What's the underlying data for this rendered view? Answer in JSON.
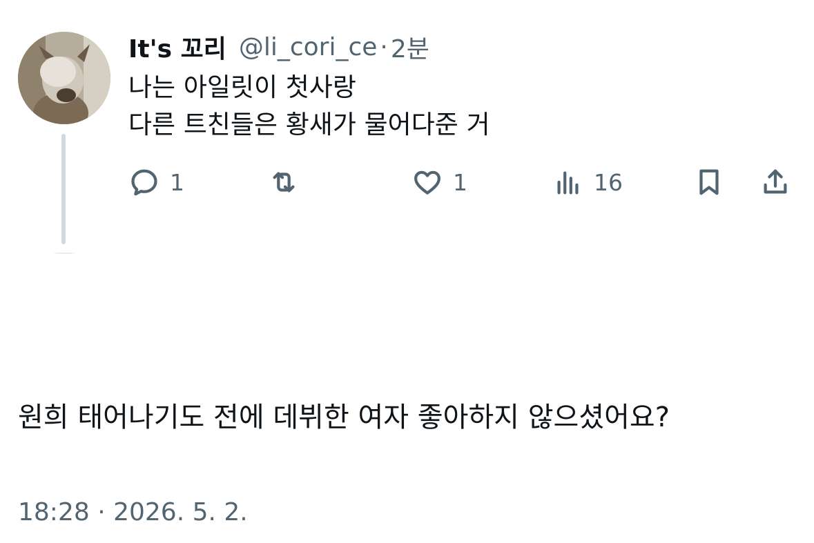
{
  "tweet": {
    "display_name": "It's 꼬리",
    "handle": "@li_cori_ce",
    "separator": "·",
    "time_ago": "2분",
    "lines": [
      "나는 아일릿이 첫사랑",
      "다른 트친들은 황새가 물어다준 거"
    ],
    "actions": {
      "reply": {
        "icon": "reply-icon",
        "count": "1"
      },
      "retweet": {
        "icon": "retweet-icon",
        "count": ""
      },
      "like": {
        "icon": "heart-icon",
        "count": "1"
      },
      "views": {
        "icon": "views-icon",
        "count": "16"
      },
      "bookmark": {
        "icon": "bookmark-icon"
      },
      "share": {
        "icon": "share-icon"
      }
    }
  },
  "reply": {
    "text": "원희 태어나기도 전에 데뷔한 여자 좋아하지 않으셨어요?",
    "timestamp": "18:28 · 2026. 5. 2."
  },
  "colors": {
    "text": "#0f1419",
    "secondary": "#536471",
    "thread_line": "#cfd9de",
    "background": "#ffffff"
  }
}
